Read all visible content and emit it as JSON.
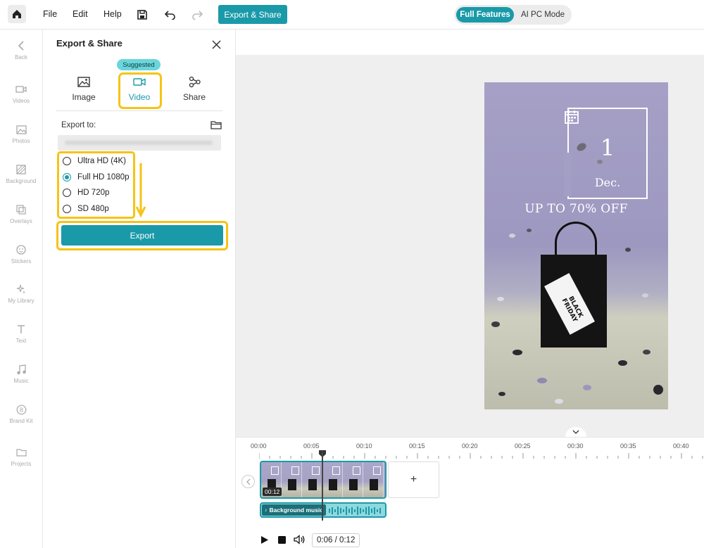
{
  "topbar": {
    "menu": [
      "File",
      "Edit",
      "Help"
    ],
    "export_share_label": "Export & Share",
    "mode_active": "Full Features",
    "mode_inactive": "AI PC Mode"
  },
  "sidebar": {
    "items": [
      {
        "label": "Back",
        "icon": "chevron-left-icon"
      },
      {
        "label": "Videos",
        "icon": "video-icon"
      },
      {
        "label": "Photos",
        "icon": "photo-icon"
      },
      {
        "label": "Background",
        "icon": "background-icon"
      },
      {
        "label": "Overlays",
        "icon": "overlays-icon"
      },
      {
        "label": "Stickers",
        "icon": "sticker-icon"
      },
      {
        "label": "My Library",
        "icon": "sparkle-icon"
      },
      {
        "label": "Text",
        "icon": "text-icon"
      },
      {
        "label": "Music",
        "icon": "music-icon"
      },
      {
        "label": "Brand Kit",
        "icon": "brand-kit-icon"
      },
      {
        "label": "Projects",
        "icon": "folder-icon"
      }
    ]
  },
  "panel": {
    "title": "Export & Share",
    "suggested_badge": "Suggested",
    "tabs": [
      {
        "label": "Image",
        "icon": "image-icon"
      },
      {
        "label": "Video",
        "icon": "video-camera-icon",
        "active": true
      },
      {
        "label": "Share",
        "icon": "share-icon"
      }
    ],
    "export_to_label": "Export to:",
    "resolutions": [
      {
        "label": "Ultra HD (4K)",
        "checked": false
      },
      {
        "label": "Full HD 1080p",
        "checked": true
      },
      {
        "label": "HD 720p",
        "checked": false
      },
      {
        "label": "SD 480p",
        "checked": false
      }
    ],
    "export_button": "Export"
  },
  "preview": {
    "day": "1",
    "month": "Dec.",
    "promo": "UP TO 70% OFF",
    "bag_text_1": "BLACK",
    "bag_text_2": "FRIDAY"
  },
  "timeline": {
    "ticks": [
      "00:00",
      "00:05",
      "00:10",
      "00:15",
      "00:20",
      "00:25",
      "00:30",
      "00:35",
      "00:40"
    ],
    "clip_duration": "00:12",
    "audio_label": "Background music",
    "add_clip_label": "+",
    "time_display": "0:06 / 0:12"
  },
  "colors": {
    "accent": "#1a9aa8",
    "highlight": "#f6c316"
  }
}
